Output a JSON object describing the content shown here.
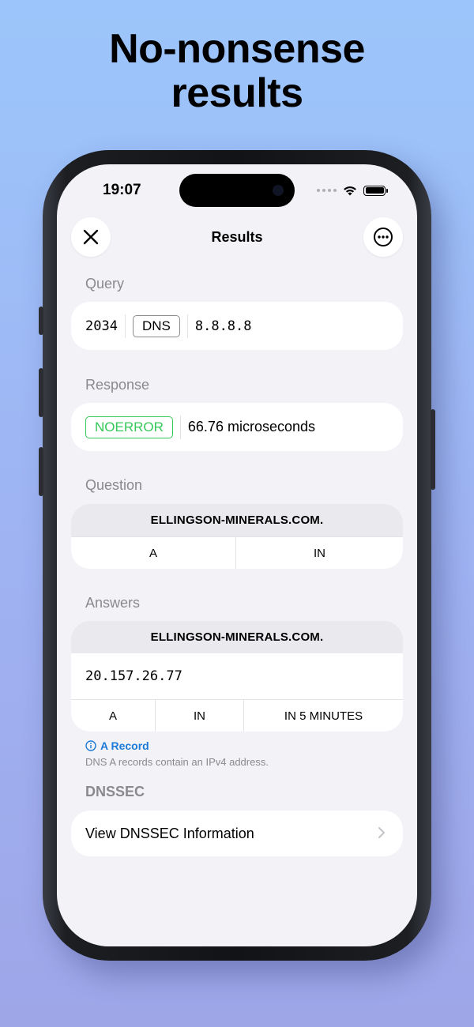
{
  "headline": {
    "line1": "No-nonsense",
    "line2": "results"
  },
  "status_bar": {
    "time": "19:07"
  },
  "nav": {
    "title": "Results",
    "close_icon": "close-icon",
    "more_icon": "ellipsis-circle-icon"
  },
  "query": {
    "label": "Query",
    "id": "2034",
    "protocol": "DNS",
    "server": "8.8.8.8"
  },
  "response": {
    "label": "Response",
    "status": "NOERROR",
    "status_color": "#34c759",
    "duration": "66.76 microseconds"
  },
  "question": {
    "label": "Question",
    "domain": "ELLINGSON-MINERALS.COM.",
    "type": "A",
    "class": "IN"
  },
  "answers": {
    "label": "Answers",
    "domain": "ELLINGSON-MINERALS.COM.",
    "value": "20.157.26.77",
    "type": "A",
    "class": "IN",
    "ttl": "IN 5 MINUTES",
    "info_title": "A Record",
    "info_desc": "DNS A records contain an IPv4 address.",
    "info_color": "#1d7bd7"
  },
  "dnssec": {
    "label": "DNSSEC",
    "link": "View DNSSEC Information"
  }
}
